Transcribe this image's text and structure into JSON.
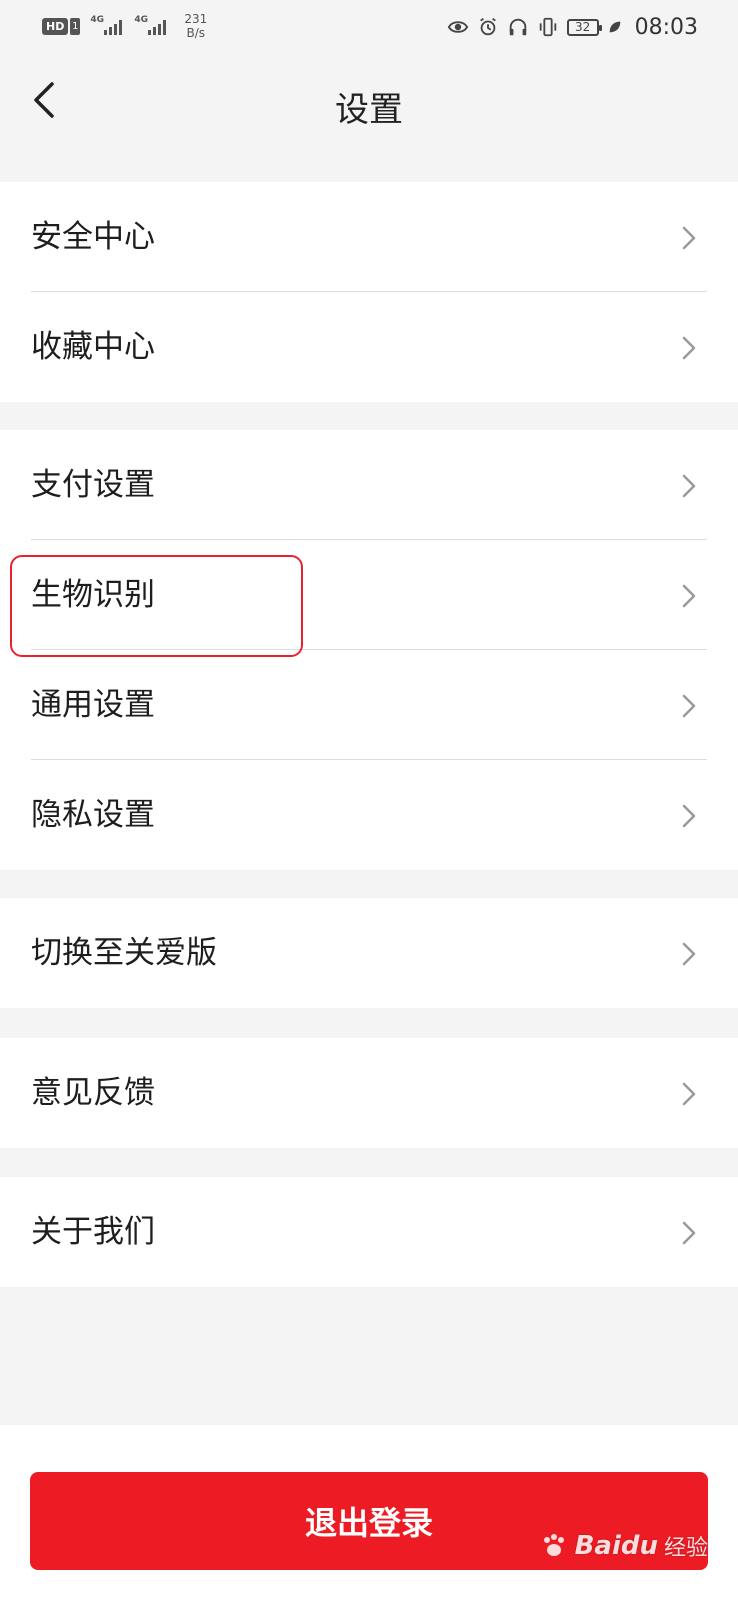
{
  "status_bar": {
    "hd_label": "HD",
    "sim_number": "1",
    "signal_1_tag": "4G",
    "signal_2_tag": "4G",
    "net_speed_value": "231",
    "net_speed_unit": "B/s",
    "battery_level": "32",
    "time": "08:03"
  },
  "header": {
    "title": "设置",
    "back_icon": "chevron-left-icon"
  },
  "groups": [
    {
      "items": [
        {
          "label": "安全中心"
        },
        {
          "label": "收藏中心"
        }
      ]
    },
    {
      "items": [
        {
          "label": "支付设置"
        },
        {
          "label": "生物识别"
        },
        {
          "label": "通用设置"
        },
        {
          "label": "隐私设置"
        }
      ]
    },
    {
      "items": [
        {
          "label": "切换至关爱版"
        }
      ]
    },
    {
      "items": [
        {
          "label": "意见反馈"
        }
      ]
    },
    {
      "items": [
        {
          "label": "关于我们"
        }
      ]
    }
  ],
  "highlighted_item": "生物识别",
  "logout": {
    "label": "退出登录"
  },
  "watermark": {
    "brand": "Baidu",
    "sub": "经验"
  },
  "colors": {
    "accent_red": "#ed1c24",
    "highlight_border": "#e8232f",
    "background": "#f4f4f4"
  }
}
